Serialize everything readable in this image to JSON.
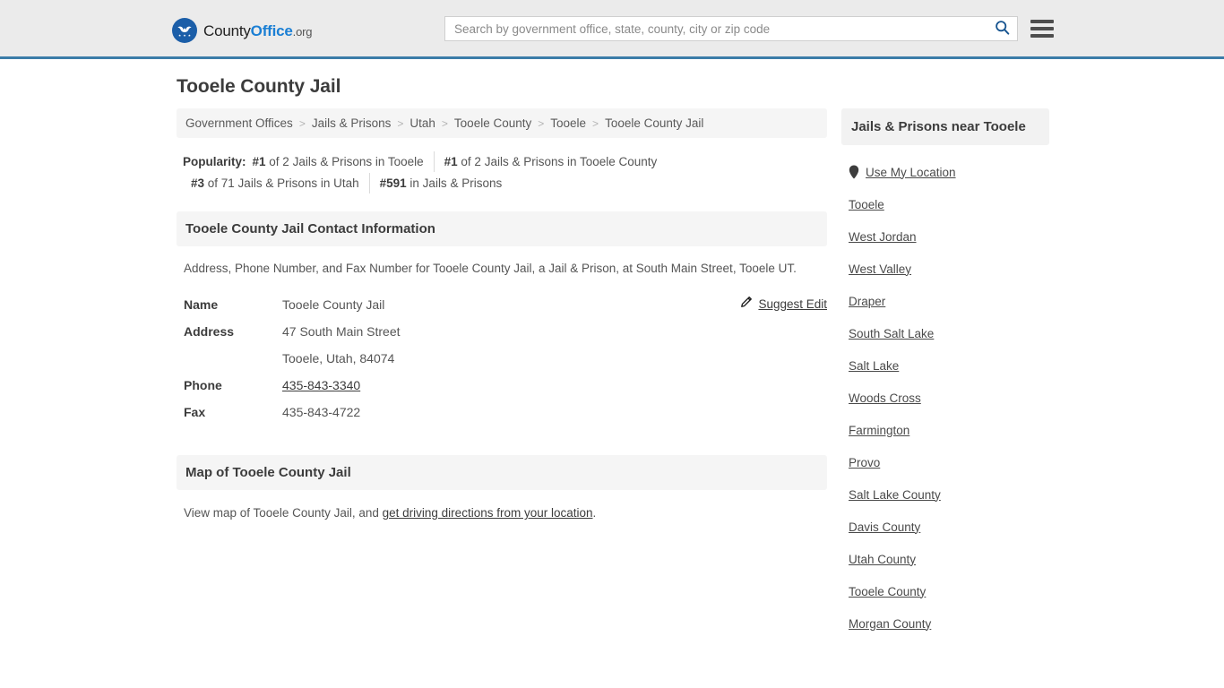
{
  "header": {
    "logo": {
      "icon": "eagle-seal-icon",
      "text_part1": "County",
      "text_part2": "Office",
      "text_part3": ".org"
    },
    "search": {
      "placeholder": "Search by government office, state, county, city or zip code",
      "value": "",
      "icon": "search-icon"
    },
    "menu_icon": "hamburger-menu-icon",
    "accent_color": "#3b7ca8",
    "background_color": "#ebebeb"
  },
  "main": {
    "title": "Tooele County Jail",
    "breadcrumb": {
      "separator": ">",
      "items": [
        {
          "label": "Government Offices"
        },
        {
          "label": "Jails & Prisons"
        },
        {
          "label": "Utah"
        },
        {
          "label": "Tooele County"
        },
        {
          "label": "Tooele"
        },
        {
          "label": "Tooele County Jail"
        }
      ]
    },
    "popularity": {
      "label": "Popularity:",
      "items": [
        {
          "rank": "#1",
          "text": " of 2 Jails & Prisons in Tooele"
        },
        {
          "rank": "#1",
          "text": " of 2 Jails & Prisons in Tooele County"
        },
        {
          "rank": "#3",
          "text": " of 71 Jails & Prisons in Utah"
        },
        {
          "rank": "#591",
          "text": " in Jails & Prisons"
        }
      ]
    },
    "contact_section": {
      "heading": "Tooele County Jail Contact Information",
      "description": "Address, Phone Number, and Fax Number for Tooele County Jail, a Jail & Prison, at South Main Street, Tooele UT.",
      "suggest_edit": {
        "label": "Suggest Edit",
        "icon": "edit-pencil-icon"
      },
      "rows": [
        {
          "key": "Name",
          "value": "Tooele County Jail",
          "link": false
        },
        {
          "key": "Address",
          "value": "47 South Main Street",
          "link": false
        },
        {
          "key": "",
          "value": "Tooele, Utah, 84074",
          "link": false
        },
        {
          "key": "Phone",
          "value": "435-843-3340",
          "link": true
        },
        {
          "key": "Fax",
          "value": "435-843-4722",
          "link": false
        }
      ]
    },
    "map_section": {
      "heading": "Map of Tooele County Jail",
      "description_prefix": "View map of Tooele County Jail, and ",
      "description_link": "get driving directions from your location",
      "description_suffix": "."
    }
  },
  "aside": {
    "heading": "Jails & Prisons near Tooele",
    "use_my_location": {
      "label": "Use My Location",
      "icon": "map-pin-icon"
    },
    "items": [
      {
        "label": "Tooele"
      },
      {
        "label": "West Jordan"
      },
      {
        "label": "West Valley"
      },
      {
        "label": "Draper"
      },
      {
        "label": "South Salt Lake"
      },
      {
        "label": "Salt Lake"
      },
      {
        "label": "Woods Cross"
      },
      {
        "label": "Farmington"
      },
      {
        "label": "Provo"
      },
      {
        "label": "Salt Lake County"
      },
      {
        "label": "Davis County"
      },
      {
        "label": "Utah County"
      },
      {
        "label": "Tooele County"
      },
      {
        "label": "Morgan County"
      }
    ]
  }
}
